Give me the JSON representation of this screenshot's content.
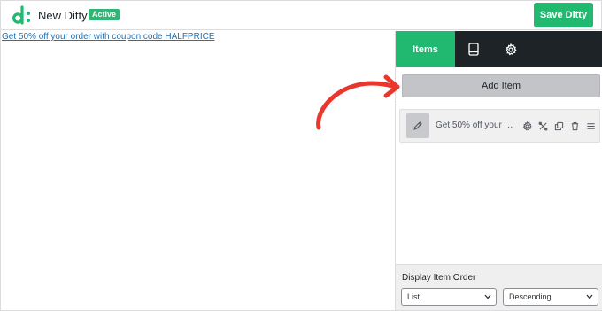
{
  "header": {
    "app_title": "New Ditty",
    "status_badge": "Active",
    "save_label": "Save Ditty"
  },
  "preview": {
    "ticker_text": "Get 50% off your order with coupon code HALFPRICE"
  },
  "sidebar": {
    "tabs": [
      {
        "label": "Items",
        "active": true
      },
      {
        "label": "",
        "icon": "display-icon"
      },
      {
        "label": "",
        "icon": "gear-icon"
      }
    ],
    "add_item_label": "Add Item",
    "items": [
      {
        "label": "Get 50% off your or..."
      }
    ],
    "order": {
      "label": "Display Item Order",
      "order_by": "List",
      "direction": "Descending"
    }
  },
  "colors": {
    "accent": "#20b96f",
    "tab_bar": "#1d2327",
    "arrow": "#e8372c",
    "link": "#2271b1"
  }
}
